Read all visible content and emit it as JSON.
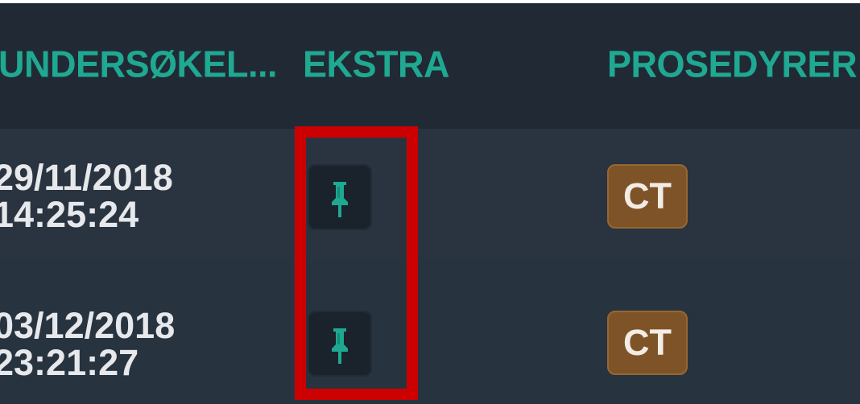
{
  "table": {
    "headers": {
      "date": "UNDERSØKEL...",
      "extra": "EKSTRA",
      "procedures": "PROSEDYRER"
    },
    "rows": [
      {
        "date": "29/11/2018\n14:25:24",
        "extra_icon": "pushpin-icon",
        "procedure": "CT"
      },
      {
        "date": "03/12/2018\n23:21:27",
        "extra_icon": "pushpin-icon",
        "procedure": "CT"
      }
    ]
  },
  "colors": {
    "background": "#222b35",
    "header_text": "#1fa892",
    "row_text": "#e6e8eb",
    "pin": "#1fa892",
    "badge": "#7f5328",
    "highlight": "#cc0000"
  }
}
